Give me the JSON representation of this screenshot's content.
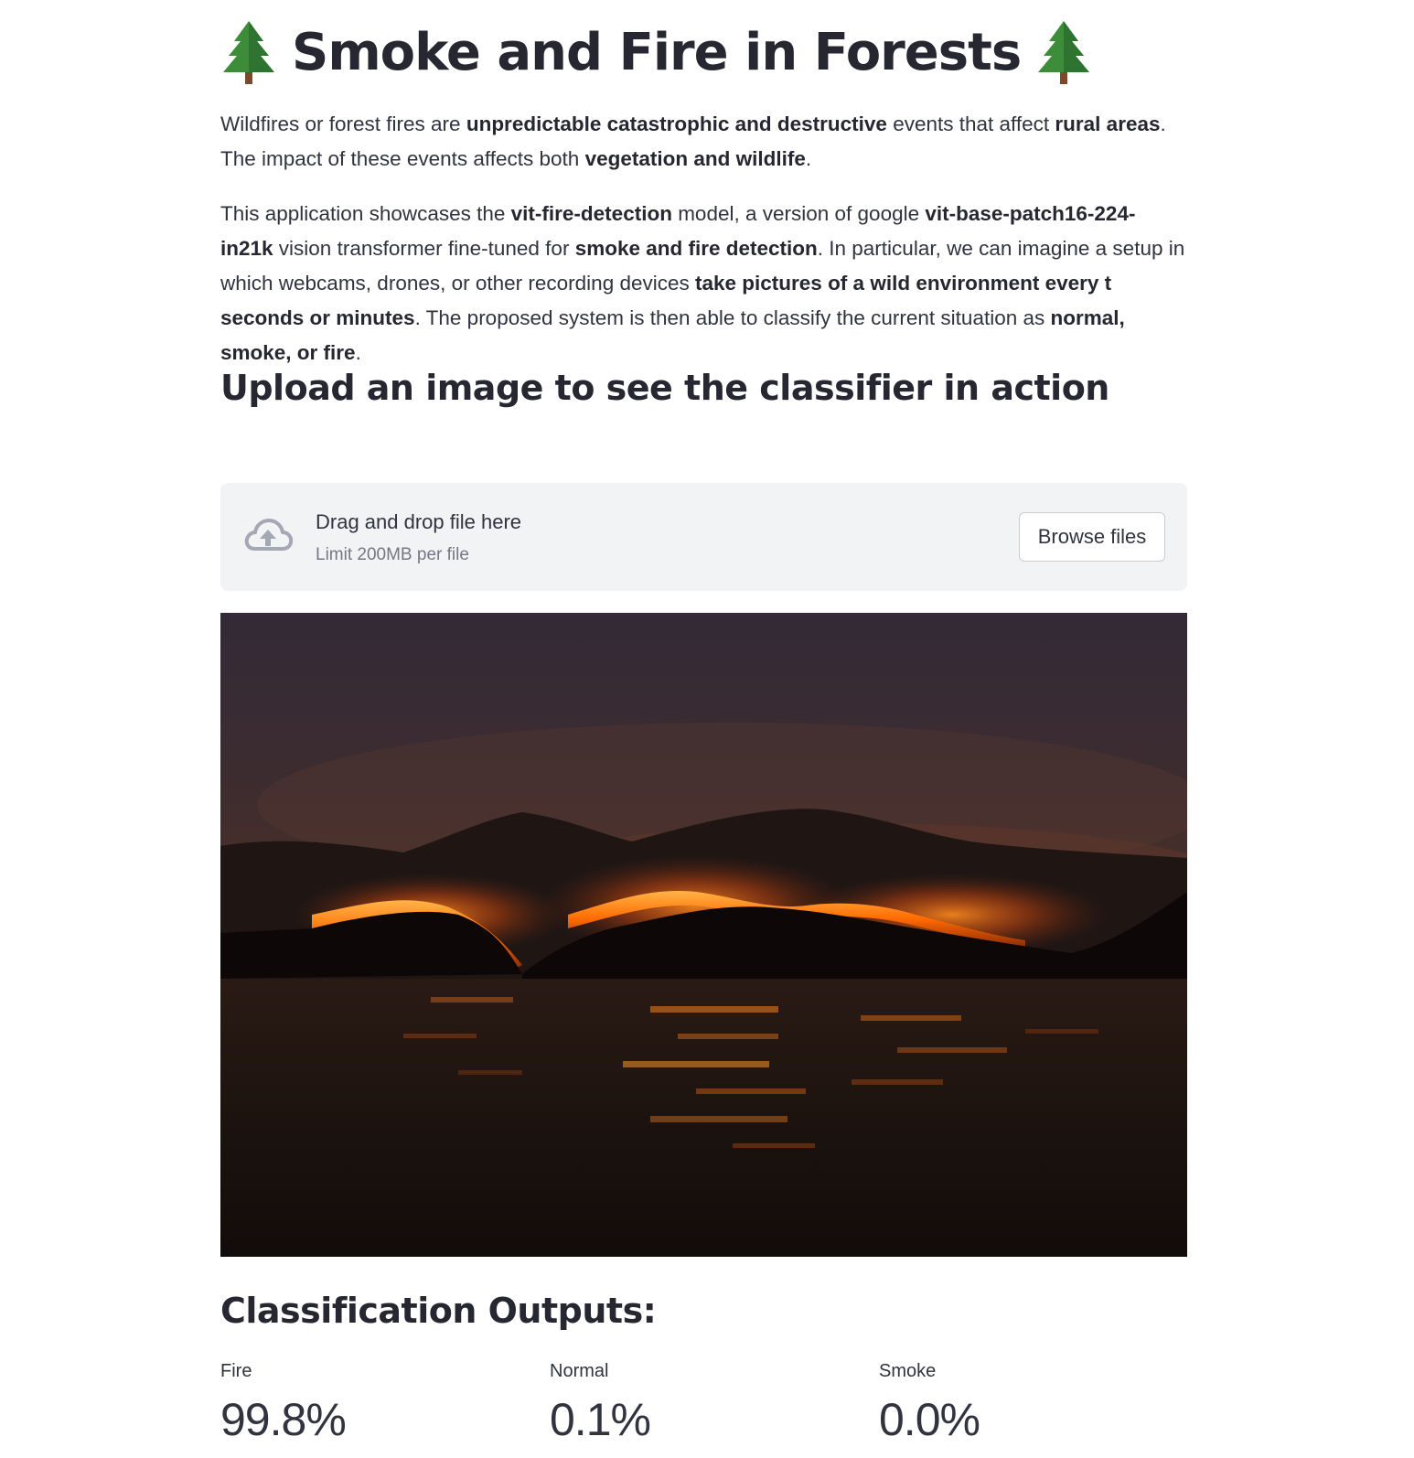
{
  "title": {
    "text": "Smoke and Fire in Forests",
    "icon_left": "evergreen-tree-icon",
    "icon_right": "evergreen-tree-icon"
  },
  "intro": {
    "p1": {
      "s1": "Wildfires or forest fires are ",
      "b1": "unpredictable catastrophic and destructive",
      "s2": " events that affect ",
      "b2": "rural areas",
      "s3": ". The impact of these events affects both ",
      "b3": "vegetation and wildlife",
      "s4": "."
    },
    "p2": {
      "s1": "This application showcases the ",
      "b1": "vit-fire-detection",
      "s2": " model, a version of google ",
      "b2": "vit-base-patch16-224-in21k",
      "s3": " vision transformer fine-tuned for ",
      "b3": "smoke and fire detection",
      "s4": ". In particular, we can imagine a setup in which webcams, drones, or other recording devices ",
      "b4": "take pictures of a wild environment every t seconds or minutes",
      "s5": ". The proposed system is then able to classify the current situation as ",
      "b5": "normal, smoke, or fire",
      "s6": "."
    }
  },
  "upload_header": "Upload an image to see the classifier in action",
  "uploader": {
    "icon": "cloud-upload-icon",
    "main_text": "Drag and drop file here",
    "sub_text": "Limit 200MB per file",
    "button_label": "Browse files"
  },
  "outputs": {
    "title": "Classification Outputs:",
    "metrics": [
      {
        "label": "Fire",
        "value": "99.8%"
      },
      {
        "label": "Normal",
        "value": "0.1%"
      },
      {
        "label": "Smoke",
        "value": "0.0%"
      }
    ]
  },
  "colors": {
    "text": "#31333f",
    "heading": "#262730",
    "uploader_bg": "#f2f3f5",
    "muted": "#757784"
  }
}
